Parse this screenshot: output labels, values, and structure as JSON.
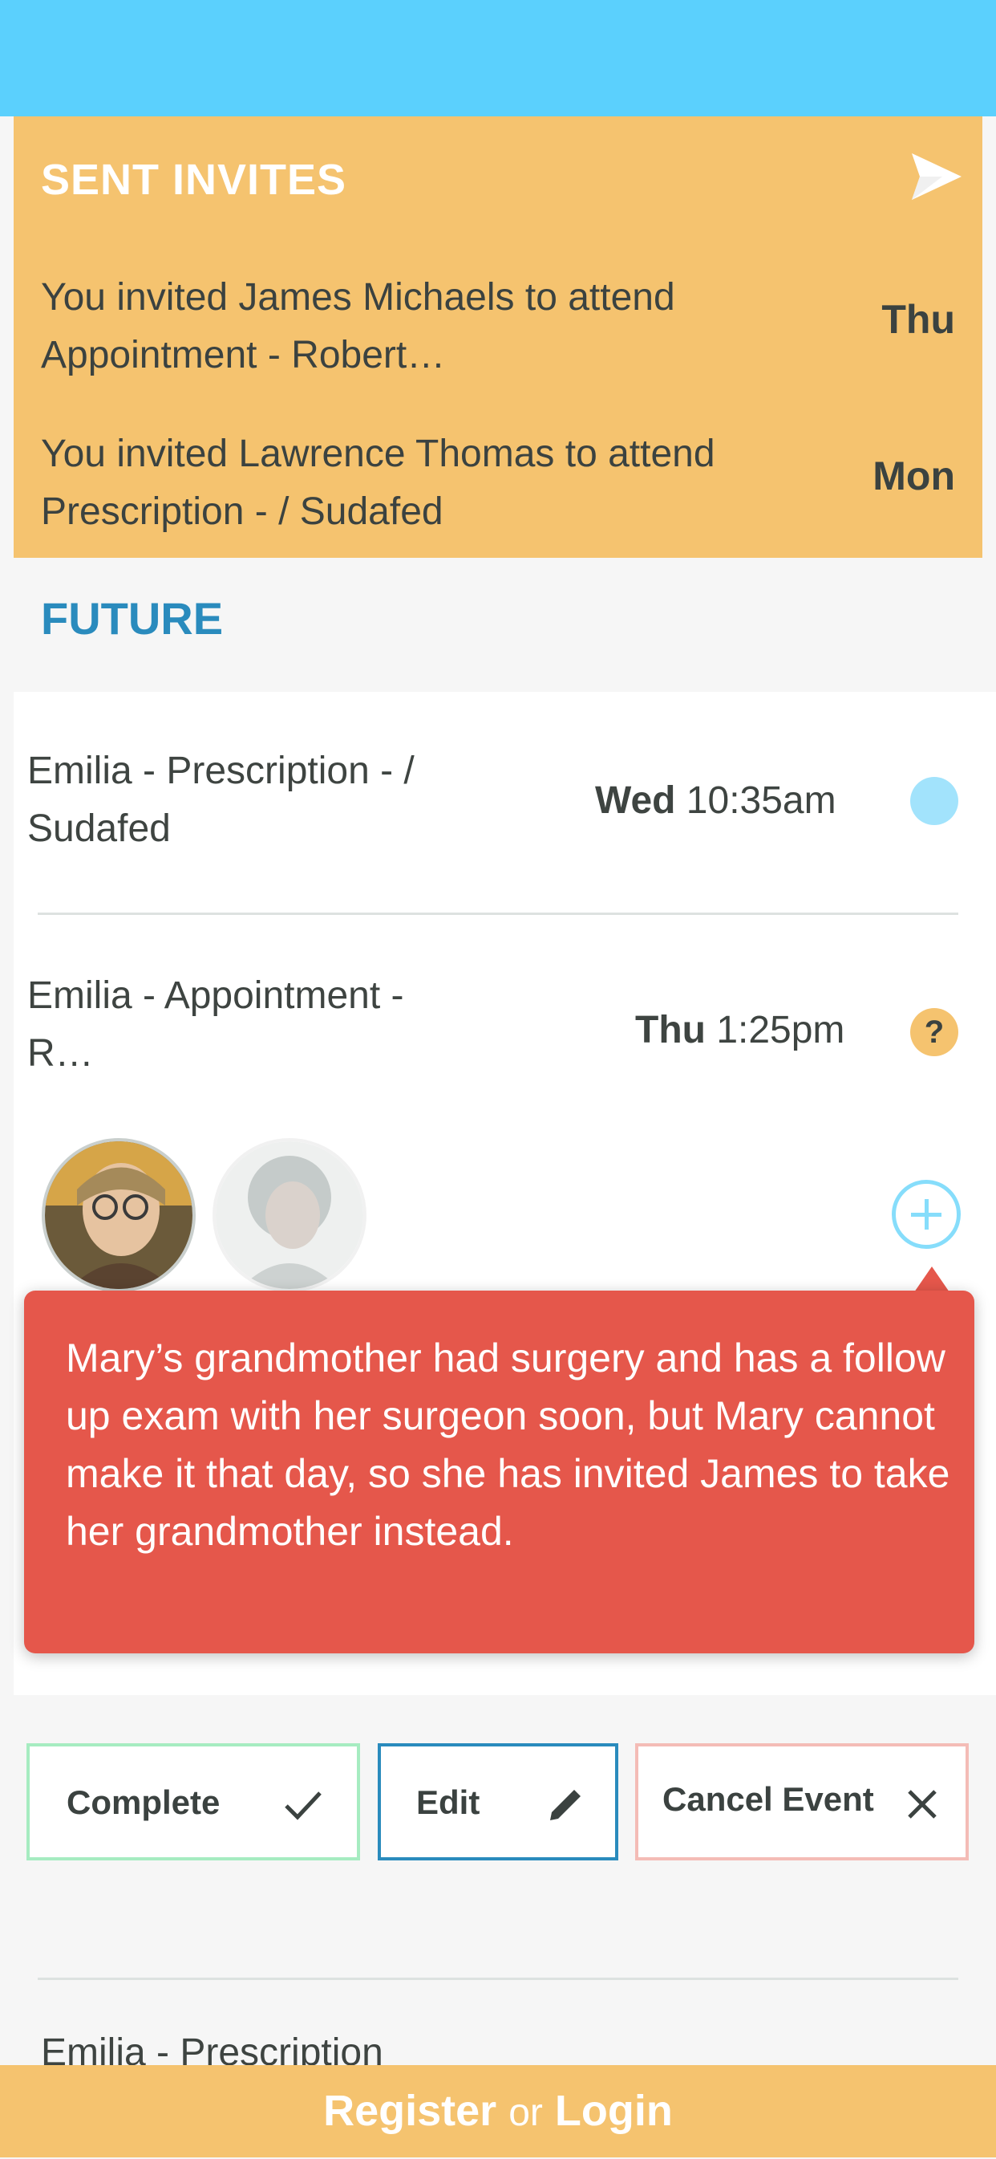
{
  "sent_invites": {
    "title": "SENT INVITES",
    "items": [
      {
        "text": "You invited James Michaels to attend Appointment - Robert…",
        "day": "Thu"
      },
      {
        "text": "You invited Lawrence Thomas to attend Prescription -  / Sudafed",
        "day": "Mon"
      }
    ]
  },
  "future": {
    "label": "FUTURE",
    "events": [
      {
        "title": "Emilia - Prescription -  / Sudafed",
        "day": "Wed",
        "time": "10:35am",
        "status_color": "#a2e3fc"
      },
      {
        "title": "Emilia - Appointment - R…",
        "day": "Thu",
        "time": "1:25pm",
        "status_symbol": "?",
        "status_color": "#f5c36f"
      }
    ],
    "peek_title": "Emilia - Prescription"
  },
  "tooltip": {
    "text": "Mary’s grandmother had surgery and has a follow up exam with her surgeon soon, but Mary cannot make it that day, so she has invited James to take her grandmother instead."
  },
  "actions": {
    "complete_label": "Complete",
    "edit_label": "Edit",
    "cancel_label": "Cancel Event"
  },
  "footer": {
    "register": "Register",
    "or": "or",
    "login": "Login"
  },
  "colors": {
    "top_bar": "#5bd0fd",
    "invites_bg": "#f5c36f",
    "future_label": "#2a8bbd",
    "tooltip_bg": "#e5574b",
    "complete_border": "#a6ecc1",
    "edit_border": "#2a8bbd",
    "cancel_border": "#f4bcb6"
  },
  "icons": {
    "send": "paper-plane-icon",
    "add": "plus-circle-icon",
    "complete": "check-icon",
    "edit": "pencil-icon",
    "cancel": "close-icon"
  }
}
